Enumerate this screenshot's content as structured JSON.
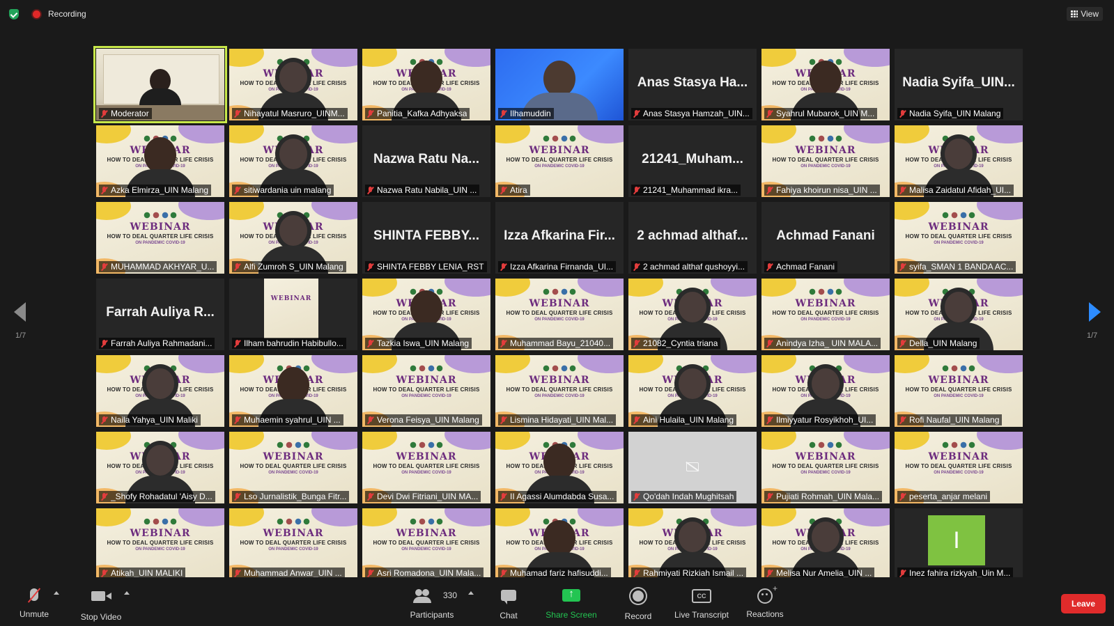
{
  "top": {
    "recording_label": "Recording",
    "view_label": "View"
  },
  "pager": {
    "left": "1/7",
    "right": "1/7"
  },
  "tiles": [
    {
      "label": "Moderator",
      "type": "moderator"
    },
    {
      "label": "Nihayatul Masruro_UINM...",
      "type": "webinar",
      "person": "hijab"
    },
    {
      "label": "Panitia_Kafka Adhyaksa",
      "type": "webinar",
      "person": "face"
    },
    {
      "label": "Ilhamuddin",
      "type": "blue"
    },
    {
      "label": "Anas Stasya Hamzah_UIN...",
      "type": "name",
      "card": "Anas Stasya Ha..."
    },
    {
      "label": "Syahrul Mubarok_UIN M...",
      "type": "webinar",
      "person": "face"
    },
    {
      "label": "Nadia Syifa_UIN Malang",
      "type": "name",
      "card": "Nadia Syifa_UIN..."
    },
    {
      "label": "Azka Elmirza_UIN Malang",
      "type": "webinar",
      "person": "face"
    },
    {
      "label": "sitiwardania uin malang",
      "type": "webinar",
      "person": "hijab"
    },
    {
      "label": "Nazwa Ratu Nabila_UIN ...",
      "type": "name",
      "card": "Nazwa Ratu Na..."
    },
    {
      "label": "Atira",
      "type": "webinar"
    },
    {
      "label": "21241_Muhammad ikra...",
      "type": "name",
      "card": "21241_Muham..."
    },
    {
      "label": "Fahiya khoirun nisa_UIN ...",
      "type": "webinar"
    },
    {
      "label": "Malisa Zaidatul Afidah_UI...",
      "type": "webinar",
      "person": "hijab"
    },
    {
      "label": "MUHAMMAD AKHYAR_U...",
      "type": "webinar"
    },
    {
      "label": "Alfi Zumroh S_UIN Malang",
      "type": "webinar",
      "person": "hijab"
    },
    {
      "label": "SHINTA FEBBY LENIA_RST",
      "type": "name",
      "card": "SHINTA FEBBY..."
    },
    {
      "label": "Izza Afkarina Firnanda_UI...",
      "type": "name",
      "card": "Izza Afkarina Fir..."
    },
    {
      "label": "2 achmad althaf qushoyyi...",
      "type": "name",
      "card": "2 achmad althaf..."
    },
    {
      "label": "Achmad Fanani",
      "type": "name",
      "card": "Achmad Fanani"
    },
    {
      "label": "syifa_SMAN 1 BANDA AC...",
      "type": "webinar"
    },
    {
      "label": "Farrah Auliya Rahmadani...",
      "type": "name",
      "card": "Farrah Auliya R..."
    },
    {
      "label": "Ilham bahrudin Habibullo...",
      "type": "thumb"
    },
    {
      "label": "Tazkia Iswa_UIN Malang",
      "type": "webinar",
      "person": "face"
    },
    {
      "label": "Muhammad Bayu_21040...",
      "type": "webinar"
    },
    {
      "label": "21082_Cyntia triana",
      "type": "webinar",
      "person": "hijab"
    },
    {
      "label": "Anindya Izha_ UIN MALA...",
      "type": "webinar"
    },
    {
      "label": "Della_UIN Malang",
      "type": "webinar",
      "person": "hijab"
    },
    {
      "label": "Naila Yahya_UIN Maliki",
      "type": "webinar",
      "person": "hijab"
    },
    {
      "label": "Muhaemin syahrul_UIN ...",
      "type": "webinar",
      "person": "face"
    },
    {
      "label": "Verona Feisya_UIN Malang",
      "type": "webinar"
    },
    {
      "label": "Lismina Hidayati_UIN Mal...",
      "type": "webinar"
    },
    {
      "label": "Aini Hulaila_UIN Malang",
      "type": "webinar",
      "person": "hijab"
    },
    {
      "label": "Ilmiyyatur Rosyikhoh_UI...",
      "type": "webinar",
      "person": "hijab"
    },
    {
      "label": "Rofi Naufal_UIN Malang",
      "type": "webinar"
    },
    {
      "label": "_Shofy Rohadatul 'Aisy D...",
      "type": "webinar",
      "person": "hijab"
    },
    {
      "label": "Lso Jurnalistik_Bunga Fitr...",
      "type": "webinar"
    },
    {
      "label": "Devi Dwi Fitriani_UIN MA...",
      "type": "webinar"
    },
    {
      "label": "II Agassi Alumdabda Susa...",
      "type": "webinar",
      "person": "face"
    },
    {
      "label": "Qo'dah Indah Mughitsah",
      "type": "camoff"
    },
    {
      "label": "Pujiati Rohmah_UIN Mala...",
      "type": "webinar"
    },
    {
      "label": "peserta_anjar melani",
      "type": "webinar"
    },
    {
      "label": "Atikah_UIN MALIKI",
      "type": "webinar"
    },
    {
      "label": "Muhammad Anwar_UIN ...",
      "type": "webinar"
    },
    {
      "label": "Asri Romadona_UIN Mala...",
      "type": "webinar"
    },
    {
      "label": "Muhamad fariz hafisuddi...",
      "type": "webinar",
      "person": "face"
    },
    {
      "label": "Rahmiyati Rizkiah Ismail ...",
      "type": "webinar",
      "person": "hijab"
    },
    {
      "label": "Melisa Nur Amelia_UIN ...",
      "type": "webinar",
      "person": "hijab"
    },
    {
      "label": "Inez fahira rizkyah_Uin M...",
      "type": "avatar",
      "initial": "I"
    }
  ],
  "webinar_card": {
    "title": "WEBINAR",
    "subtitle": "HOW TO DEAL QUARTER LIFE CRISIS",
    "subtitle2": "ON PANDEMIC COVID-19"
  },
  "toolbar": {
    "unmute": "Unmute",
    "stop_video": "Stop Video",
    "participants": "Participants",
    "participants_count": "330",
    "chat": "Chat",
    "share_screen": "Share Screen",
    "record": "Record",
    "live_transcript": "Live Transcript",
    "live_transcript_icon_text": "CC",
    "reactions": "Reactions",
    "leave": "Leave"
  },
  "colors": {
    "accent_green": "#23c552",
    "leave_red": "#e02b2b",
    "speaker_outline": "#c8e84a",
    "nav_blue": "#2d8cff"
  }
}
